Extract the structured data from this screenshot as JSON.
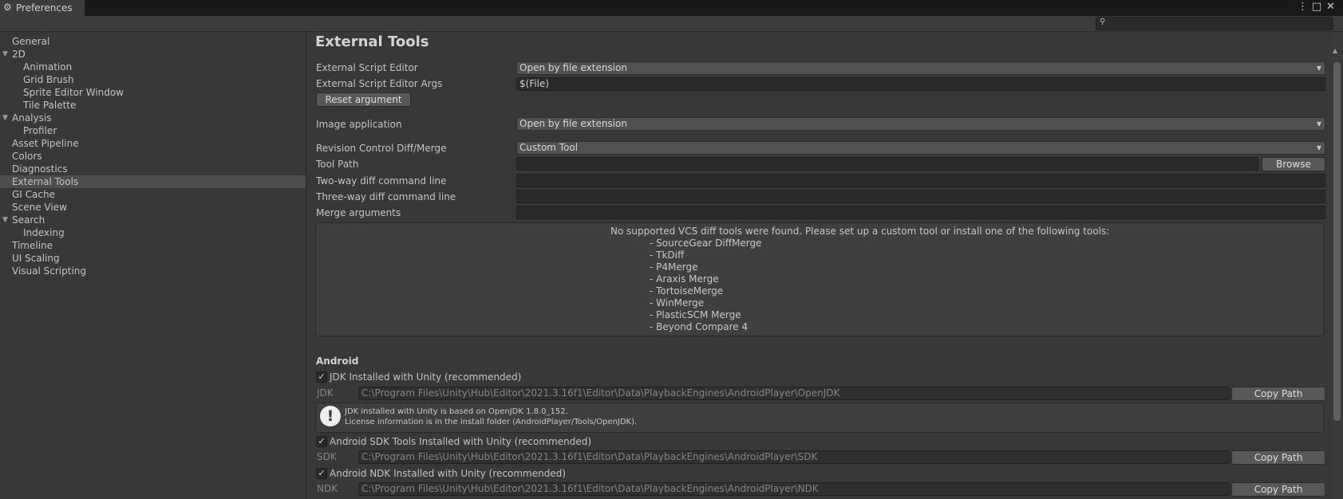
{
  "window": {
    "title": "Preferences",
    "icons": [
      "gear-icon",
      "more-icon",
      "maximize-icon",
      "close-icon"
    ]
  },
  "search": {
    "placeholder": ""
  },
  "sidebar": {
    "items": [
      {
        "label": "General"
      },
      {
        "label": "2D"
      },
      {
        "label": "Animation"
      },
      {
        "label": "Grid Brush"
      },
      {
        "label": "Sprite Editor Window"
      },
      {
        "label": "Tile Palette"
      },
      {
        "label": "Analysis"
      },
      {
        "label": "Profiler"
      },
      {
        "label": "Asset Pipeline"
      },
      {
        "label": "Colors"
      },
      {
        "label": "Diagnostics"
      },
      {
        "label": "External Tools"
      },
      {
        "label": "GI Cache"
      },
      {
        "label": "Scene View"
      },
      {
        "label": "Search"
      },
      {
        "label": "Indexing"
      },
      {
        "label": "Timeline"
      },
      {
        "label": "UI Scaling"
      },
      {
        "label": "Visual Scripting"
      }
    ],
    "selected": "External Tools"
  },
  "main": {
    "title": "External Tools",
    "script_editor": {
      "label": "External Script Editor",
      "value": "Open by file extension"
    },
    "script_editor_args": {
      "label": "External Script Editor Args",
      "value": "$(File)"
    },
    "reset_argument": "Reset argument",
    "image_application": {
      "label": "Image application",
      "value": "Open by file extension"
    },
    "revision_control": {
      "label": "Revision Control Diff/Merge",
      "value": "Custom Tool"
    },
    "tool_path": {
      "label": "Tool Path",
      "value": "",
      "browse": "Browse"
    },
    "two_way": {
      "label": "Two-way diff command line",
      "value": ""
    },
    "three_way": {
      "label": "Three-way diff command line",
      "value": ""
    },
    "merge_args": {
      "label": "Merge arguments",
      "value": ""
    },
    "vcs_message": {
      "header": "No supported VCS diff tools were found. Please set up a custom tool or install one of the following tools:",
      "tools": [
        "- SourceGear DiffMerge",
        "- TkDiff",
        "- P4Merge",
        "- Araxis Merge",
        "- TortoiseMerge",
        "- WinMerge",
        "- PlasticSCM Merge",
        "- Beyond Compare 4"
      ]
    },
    "android": {
      "heading": "Android",
      "jdk_toggle": {
        "label": "JDK Installed with Unity (recommended)",
        "checked": true
      },
      "jdk": {
        "label": "JDK",
        "value": "C:\\Program Files\\Unity\\Hub\\Editor\\2021.3.16f1\\Editor\\Data\\PlaybackEngines\\AndroidPlayer\\OpenJDK",
        "copy": "Copy Path"
      },
      "jdk_info": {
        "icon": "!",
        "line1": "JDK installed with Unity is based on OpenJDK 1.8.0_152.",
        "line2": "License information is in the install folder (AndroidPlayer/Tools/OpenJDK)."
      },
      "sdk_toggle": {
        "label": "Android SDK Tools Installed with Unity (recommended)",
        "checked": true
      },
      "sdk": {
        "label": "SDK",
        "value": "C:\\Program Files\\Unity\\Hub\\Editor\\2021.3.16f1\\Editor\\Data\\PlaybackEngines\\AndroidPlayer\\SDK",
        "copy": "Copy Path"
      },
      "ndk_toggle": {
        "label": "Android NDK Installed with Unity (recommended)",
        "checked": true
      },
      "ndk": {
        "label": "NDK",
        "value": "C:\\Program Files\\Unity\\Hub\\Editor\\2021.3.16f1\\Editor\\Data\\PlaybackEngines\\AndroidPlayer\\NDK",
        "copy": "Copy Path"
      }
    }
  },
  "glyphs": {
    "check": "✓",
    "arrow": "▼",
    "tri": "▼",
    "magnifier": "⚲",
    "gear": "⚙",
    "more": "⋮",
    "maximize": "□",
    "close": "✕"
  }
}
